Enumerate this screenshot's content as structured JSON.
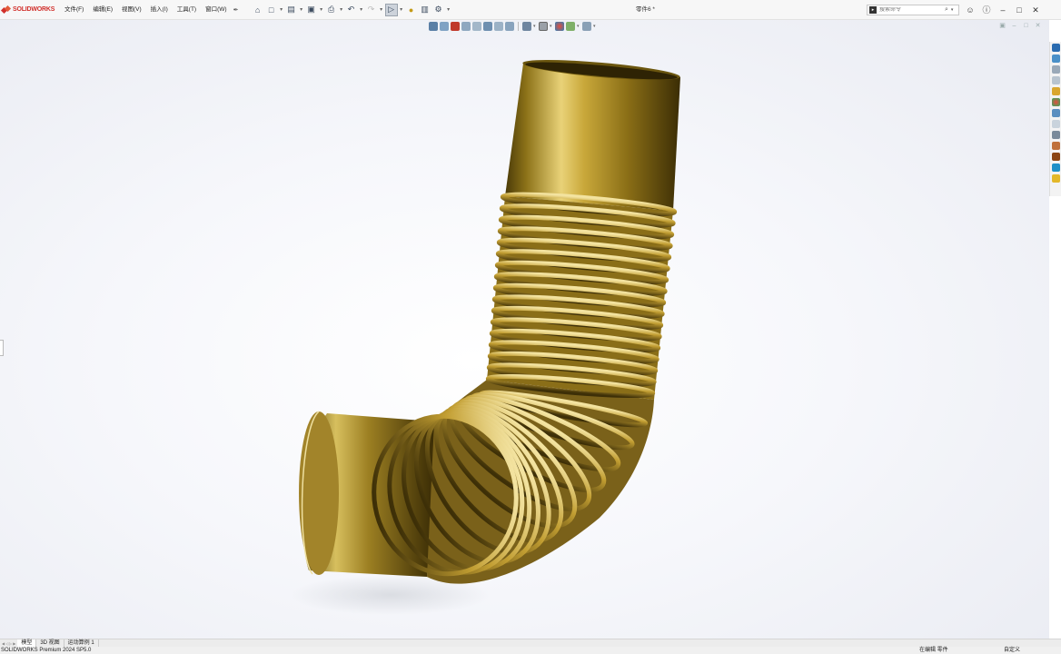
{
  "app": {
    "logo_brand": "SOLIDWORKS",
    "document_title": "零件6 *"
  },
  "menu": {
    "items": [
      "文件(F)",
      "编辑(E)",
      "视图(V)",
      "插入(I)",
      "工具(T)",
      "窗口(W)"
    ]
  },
  "search": {
    "placeholder": "搜索命令"
  },
  "bottom_tabs": [
    "模型",
    "3D 视图",
    "运动算例 1"
  ],
  "status": {
    "product": "SOLIDWORKS Premium 2024 SP5.0",
    "editing": "在编辑 零件",
    "units": "自定义"
  },
  "colors": {
    "accent": "#d1302b",
    "brass_highlight": "#e8d07a",
    "brass_mid": "#a88a2a",
    "brass_dark": "#3c2e06"
  },
  "icons": {
    "quick_access": [
      "home-icon",
      "new-file-icon",
      "open-file-icon",
      "save-icon",
      "print-icon",
      "undo-icon",
      "redo-icon",
      "select-icon",
      "rebuild-icon",
      "file-properties-icon",
      "options-icon"
    ],
    "window": [
      "user-icon",
      "help-icon",
      "minimize-icon",
      "restore-icon",
      "close-icon"
    ]
  }
}
